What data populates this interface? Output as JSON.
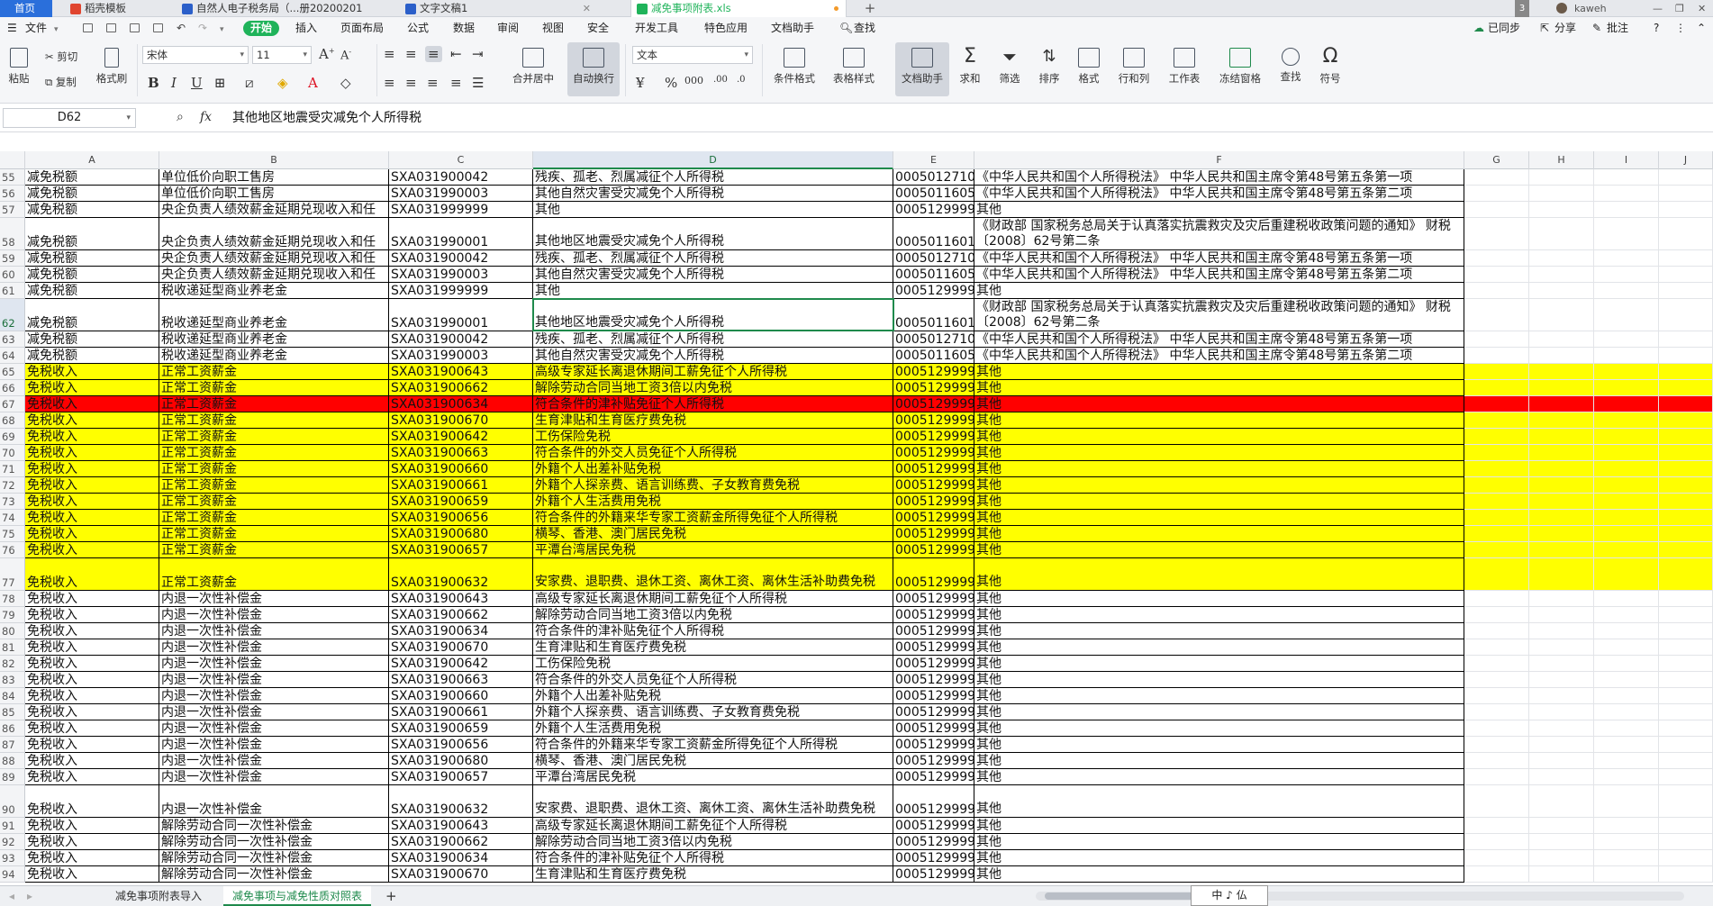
{
  "tabs": [
    {
      "label": "首页",
      "color": "#2a6fdb"
    },
    {
      "label": "稻壳模板",
      "color": "#e0452f"
    },
    {
      "label": "自然人电子税务局（...册20200201",
      "color": "#2b5fc9"
    },
    {
      "label": "文字文稿1",
      "color": "#2b5fc9"
    },
    {
      "label": "减免事项附表.xls",
      "color": "#1fb35a"
    }
  ],
  "window": {
    "badge": "3",
    "user": "kaweh"
  },
  "menu": {
    "file": "文件",
    "items": [
      "开始",
      "插入",
      "页面布局",
      "公式",
      "数据",
      "审阅",
      "视图",
      "安全",
      "开发工具",
      "特色应用",
      "文档助手"
    ],
    "search": "查找",
    "right": [
      "已同步",
      "分享",
      "批注"
    ]
  },
  "ribbon": {
    "paste": "粘贴",
    "cut": "剪切",
    "copy": "复制",
    "format_painter": "格式刷",
    "font_name": "宋体",
    "font_size": "11",
    "merge": "合并居中",
    "wrap": "自动换行",
    "number_format": "文本",
    "cond_format": "条件格式",
    "table_style": "表格样式",
    "doc_helper": "文档助手",
    "sum": "求和",
    "filter": "筛选",
    "sort": "排序",
    "format": "格式",
    "row_col": "行和列",
    "worksheet": "工作表",
    "freeze": "冻结窗格",
    "find": "查找",
    "symbol": "符号"
  },
  "formula_bar": {
    "name_box": "D62",
    "content": "其他地区地震受灾减免个人所得税"
  },
  "columns": [
    "A",
    "B",
    "C",
    "D",
    "E",
    "F",
    "G",
    "H",
    "I",
    "J"
  ],
  "colors": {
    "yellow": "#ffff00",
    "red": "#ff0000",
    "accent": "#1f8a4c"
  },
  "rows": [
    {
      "n": "55",
      "a": "减免税额",
      "b": "单位低价向职工售房",
      "c": "SXA031900042",
      "d": "残疾、孤老、烈属减征个人所得税",
      "e": "0005012710",
      "f": "《中华人民共和国个人所得税法》 中华人民共和国主席令第48号第五条第一项"
    },
    {
      "n": "56",
      "a": "减免税额",
      "b": "单位低价向职工售房",
      "c": "SXA031990003",
      "d": "其他自然灾害受灾减免个人所得税",
      "e": "0005011605",
      "f": "《中华人民共和国个人所得税法》 中华人民共和国主席令第48号第五条第二项"
    },
    {
      "n": "57",
      "a": "减免税额",
      "b": "央企负责人绩效薪金延期兑现收入和任",
      "c": "SXA031999999",
      "d": "其他",
      "e": "0005129999",
      "f": "其他"
    },
    {
      "n": "58",
      "a": "减免税额",
      "b": "央企负责人绩效薪金延期兑现收入和任",
      "c": "SXA031990001",
      "d": "其他地区地震受灾减免个人所得税",
      "e": "0005011601",
      "f": "《财政部 国家税务总局关于认真落实抗震救灾及灾后重建税收政策问题的通知》 财税〔2008〕62号第二条"
    },
    {
      "n": "59",
      "a": "减免税额",
      "b": "央企负责人绩效薪金延期兑现收入和任",
      "c": "SXA031900042",
      "d": "残疾、孤老、烈属减征个人所得税",
      "e": "0005012710",
      "f": "《中华人民共和国个人所得税法》 中华人民共和国主席令第48号第五条第一项"
    },
    {
      "n": "60",
      "a": "减免税额",
      "b": "央企负责人绩效薪金延期兑现收入和任",
      "c": "SXA031990003",
      "d": "其他自然灾害受灾减免个人所得税",
      "e": "0005011605",
      "f": "《中华人民共和国个人所得税法》 中华人民共和国主席令第48号第五条第二项"
    },
    {
      "n": "61",
      "a": "减免税额",
      "b": "税收递延型商业养老金",
      "c": "SXA031999999",
      "d": "其他",
      "e": "0005129999",
      "f": "其他"
    },
    {
      "n": "62",
      "a": "减免税额",
      "b": "税收递延型商业养老金",
      "c": "SXA031990001",
      "d": "其他地区地震受灾减免个人所得税",
      "e": "0005011601",
      "f": "《财政部 国家税务总局关于认真落实抗震救灾及灾后重建税收政策问题的通知》 财税〔2008〕62号第二条"
    },
    {
      "n": "63",
      "a": "减免税额",
      "b": "税收递延型商业养老金",
      "c": "SXA031900042",
      "d": "残疾、孤老、烈属减征个人所得税",
      "e": "0005012710",
      "f": "《中华人民共和国个人所得税法》 中华人民共和国主席令第48号第五条第一项"
    },
    {
      "n": "64",
      "a": "减免税额",
      "b": "税收递延型商业养老金",
      "c": "SXA031990003",
      "d": "其他自然灾害受灾减免个人所得税",
      "e": "0005011605",
      "f": "《中华人民共和国个人所得税法》 中华人民共和国主席令第48号第五条第二项"
    },
    {
      "n": "65",
      "a": "免税收入",
      "b": "正常工资薪金",
      "c": "SXA031900643",
      "d": "高级专家延长离退休期间工薪免征个人所得税",
      "e": "0005129999",
      "f": "其他",
      "fill": "yellow"
    },
    {
      "n": "66",
      "a": "免税收入",
      "b": "正常工资薪金",
      "c": "SXA031900662",
      "d": "解除劳动合同当地工资3倍以内免税",
      "e": "0005129999",
      "f": "其他",
      "fill": "yellow"
    },
    {
      "n": "67",
      "a": "免税收入",
      "b": "正常工资薪金",
      "c": "SXA031900634",
      "d": "符合条件的津补贴免征个人所得税",
      "e": "0005129999",
      "f": "其他",
      "fill": "red"
    },
    {
      "n": "68",
      "a": "免税收入",
      "b": "正常工资薪金",
      "c": "SXA031900670",
      "d": "生育津贴和生育医疗费免税",
      "e": "0005129999",
      "f": "其他",
      "fill": "yellow"
    },
    {
      "n": "69",
      "a": "免税收入",
      "b": "正常工资薪金",
      "c": "SXA031900642",
      "d": "工伤保险免税",
      "e": "0005129999",
      "f": "其他",
      "fill": "yellow"
    },
    {
      "n": "70",
      "a": "免税收入",
      "b": "正常工资薪金",
      "c": "SXA031900663",
      "d": "符合条件的外交人员免征个人所得税",
      "e": "0005129999",
      "f": "其他",
      "fill": "yellow"
    },
    {
      "n": "71",
      "a": "免税收入",
      "b": "正常工资薪金",
      "c": "SXA031900660",
      "d": "外籍个人出差补贴免税",
      "e": "0005129999",
      "f": "其他",
      "fill": "yellow"
    },
    {
      "n": "72",
      "a": "免税收入",
      "b": "正常工资薪金",
      "c": "SXA031900661",
      "d": "外籍个人探亲费、语言训练费、子女教育费免税",
      "e": "0005129999",
      "f": "其他",
      "fill": "yellow"
    },
    {
      "n": "73",
      "a": "免税收入",
      "b": "正常工资薪金",
      "c": "SXA031900659",
      "d": "外籍个人生活费用免税",
      "e": "0005129999",
      "f": "其他",
      "fill": "yellow"
    },
    {
      "n": "74",
      "a": "免税收入",
      "b": "正常工资薪金",
      "c": "SXA031900656",
      "d": "符合条件的外籍来华专家工资薪金所得免征个人所得税",
      "e": "0005129999",
      "f": "其他",
      "fill": "yellow"
    },
    {
      "n": "75",
      "a": "免税收入",
      "b": "正常工资薪金",
      "c": "SXA031900680",
      "d": "横琴、香港、澳门居民免税",
      "e": "0005129999",
      "f": "其他",
      "fill": "yellow"
    },
    {
      "n": "76",
      "a": "免税收入",
      "b": "正常工资薪金",
      "c": "SXA031900657",
      "d": "平潭台湾居民免税",
      "e": "0005129999",
      "f": "其他",
      "fill": "yellow"
    },
    {
      "n": "77",
      "a": "免税收入",
      "b": "正常工资薪金",
      "c": "SXA031900632",
      "d": "安家费、退职费、退休工资、离休工资、离休生活补助费免税",
      "e": "0005129999",
      "f": "其他",
      "fill": "yellow"
    },
    {
      "n": "78",
      "a": "免税收入",
      "b": "内退一次性补偿金",
      "c": "SXA031900643",
      "d": "高级专家延长离退休期间工薪免征个人所得税",
      "e": "0005129999",
      "f": "其他"
    },
    {
      "n": "79",
      "a": "免税收入",
      "b": "内退一次性补偿金",
      "c": "SXA031900662",
      "d": "解除劳动合同当地工资3倍以内免税",
      "e": "0005129999",
      "f": "其他"
    },
    {
      "n": "80",
      "a": "免税收入",
      "b": "内退一次性补偿金",
      "c": "SXA031900634",
      "d": "符合条件的津补贴免征个人所得税",
      "e": "0005129999",
      "f": "其他"
    },
    {
      "n": "81",
      "a": "免税收入",
      "b": "内退一次性补偿金",
      "c": "SXA031900670",
      "d": "生育津贴和生育医疗费免税",
      "e": "0005129999",
      "f": "其他"
    },
    {
      "n": "82",
      "a": "免税收入",
      "b": "内退一次性补偿金",
      "c": "SXA031900642",
      "d": "工伤保险免税",
      "e": "0005129999",
      "f": "其他"
    },
    {
      "n": "83",
      "a": "免税收入",
      "b": "内退一次性补偿金",
      "c": "SXA031900663",
      "d": "符合条件的外交人员免征个人所得税",
      "e": "0005129999",
      "f": "其他"
    },
    {
      "n": "84",
      "a": "免税收入",
      "b": "内退一次性补偿金",
      "c": "SXA031900660",
      "d": "外籍个人出差补贴免税",
      "e": "0005129999",
      "f": "其他"
    },
    {
      "n": "85",
      "a": "免税收入",
      "b": "内退一次性补偿金",
      "c": "SXA031900661",
      "d": "外籍个人探亲费、语言训练费、子女教育费免税",
      "e": "0005129999",
      "f": "其他"
    },
    {
      "n": "86",
      "a": "免税收入",
      "b": "内退一次性补偿金",
      "c": "SXA031900659",
      "d": "外籍个人生活费用免税",
      "e": "0005129999",
      "f": "其他"
    },
    {
      "n": "87",
      "a": "免税收入",
      "b": "内退一次性补偿金",
      "c": "SXA031900656",
      "d": "符合条件的外籍来华专家工资薪金所得免征个人所得税",
      "e": "0005129999",
      "f": "其他"
    },
    {
      "n": "88",
      "a": "免税收入",
      "b": "内退一次性补偿金",
      "c": "SXA031900680",
      "d": "横琴、香港、澳门居民免税",
      "e": "0005129999",
      "f": "其他"
    },
    {
      "n": "89",
      "a": "免税收入",
      "b": "内退一次性补偿金",
      "c": "SXA031900657",
      "d": "平潭台湾居民免税",
      "e": "0005129999",
      "f": "其他"
    },
    {
      "n": "90",
      "a": "免税收入",
      "b": "内退一次性补偿金",
      "c": "SXA031900632",
      "d": "安家费、退职费、退休工资、离休工资、离休生活补助费免税",
      "e": "0005129999",
      "f": "其他"
    },
    {
      "n": "91",
      "a": "免税收入",
      "b": "解除劳动合同一次性补偿金",
      "c": "SXA031900643",
      "d": "高级专家延长离退休期间工薪免征个人所得税",
      "e": "0005129999",
      "f": "其他"
    },
    {
      "n": "92",
      "a": "免税收入",
      "b": "解除劳动合同一次性补偿金",
      "c": "SXA031900662",
      "d": "解除劳动合同当地工资3倍以内免税",
      "e": "0005129999",
      "f": "其他"
    },
    {
      "n": "93",
      "a": "免税收入",
      "b": "解除劳动合同一次性补偿金",
      "c": "SXA031900634",
      "d": "符合条件的津补贴免征个人所得税",
      "e": "0005129999",
      "f": "其他"
    },
    {
      "n": "94",
      "a": "免税收入",
      "b": "解除劳动合同一次性补偿金",
      "c": "SXA031900670",
      "d": "生育津贴和生育医疗费免税",
      "e": "0005129999",
      "f": "其他"
    }
  ],
  "sheets": [
    "减免事项附表导入",
    "减免事项与减免性质对照表"
  ],
  "ime": "中 ♪ 仏"
}
